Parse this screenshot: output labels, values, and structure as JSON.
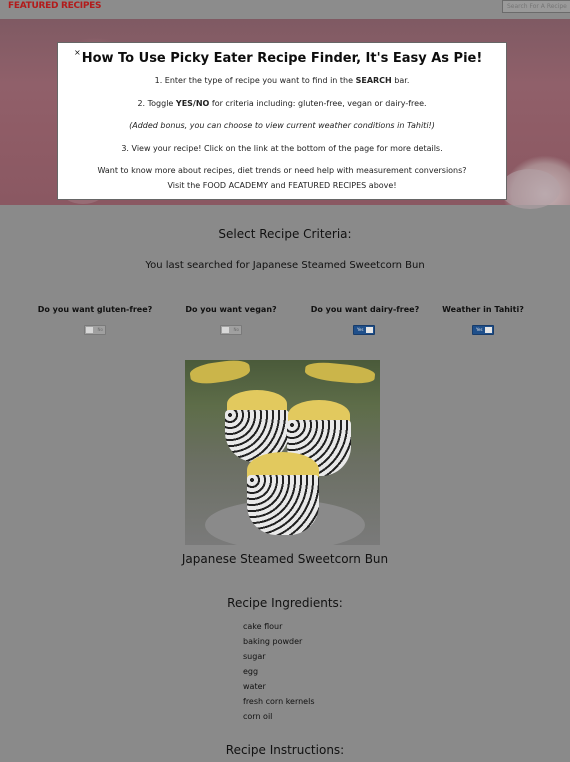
{
  "nav": {
    "brand": "FEATURED RECIPES",
    "search_placeholder": "Search For A Recipe"
  },
  "modal": {
    "close": "×",
    "title": "How To Use Picky Eater Recipe Finder, It's Easy As Pie!",
    "step1_prefix": "1. Enter the type of recipe you want to find in the ",
    "step1_bold": "SEARCH",
    "step1_suffix": " bar.",
    "step2_prefix": "2. Toggle ",
    "step2_bold": "YES/NO",
    "step2_suffix": " for criteria including: gluten-free, vegan or dairy-free.",
    "bonus": "(Added bonus, you can choose to view current weather conditions in Tahiti!)",
    "step3": "3. View your recipe! Click on the link at the bottom of the page for more details.",
    "more_line1": "Want to know more about recipes, diet trends or need help with measurement conversions?",
    "more_line2": "Visit the FOOD ACADEMY and FEATURED RECIPES above!"
  },
  "main": {
    "select_heading": "Select Recipe Criteria:",
    "last_search": "You last searched for Japanese Steamed Sweetcorn Bun",
    "criteria": [
      {
        "label": "Do you want gluten-free?",
        "state": "No"
      },
      {
        "label": "Do you want vegan?",
        "state": "No"
      },
      {
        "label": "Do you want dairy-free?",
        "state": "Yes"
      },
      {
        "label": "Weather in Tahiti?",
        "state": "Yes"
      }
    ]
  },
  "recipe": {
    "title": "Japanese Steamed Sweetcorn Bun",
    "ingredients_heading": "Recipe Ingredients:",
    "ingredients": [
      "cake flour",
      "baking powder",
      "sugar",
      "egg",
      "water",
      "fresh corn kernels",
      "corn oil"
    ],
    "instructions_heading": "Recipe Instructions:"
  },
  "colors": {
    "brand": "#b21b1b",
    "toggle_on": "#1f4f8a",
    "toggle_off": "#a0a0a0",
    "page_bg": "#8a8a8a"
  }
}
